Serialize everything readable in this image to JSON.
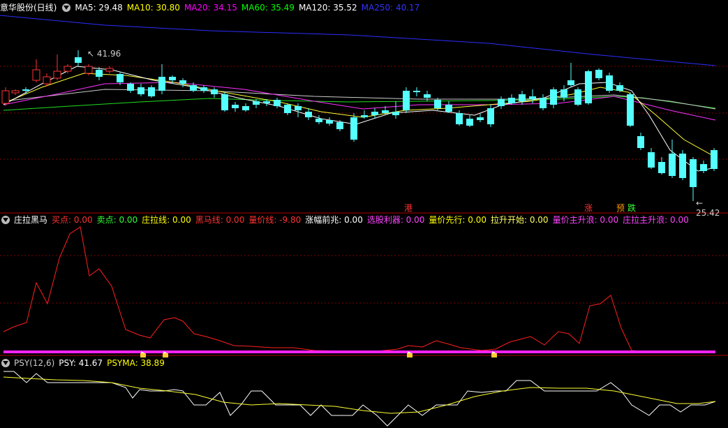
{
  "price_panel": {
    "title": "意华股份(日线)",
    "title_color": "#ffffff",
    "indicators": [
      {
        "label": "MA5: 29.48",
        "color": "#ffffff"
      },
      {
        "label": "MA10: 30.80",
        "color": "#ffff00"
      },
      {
        "label": "MA20: 34.15",
        "color": "#ff00ff"
      },
      {
        "label": "MA60: 35.49",
        "color": "#00ff00"
      },
      {
        "label": "MA120: 35.52",
        "color": "#ffffff"
      },
      {
        "label": "MA250: 40.17",
        "color": "#3333ff"
      }
    ],
    "high_label": "41.96",
    "low_label": "25.42",
    "signals": [
      {
        "text": "港",
        "color": "#ff3333"
      },
      {
        "text": "涨",
        "color": "#ff3333"
      },
      {
        "text": "预",
        "color": "#ff9900"
      },
      {
        "text": "跌",
        "color": "#33ff33"
      }
    ]
  },
  "zlhm_panel": {
    "title": "庄拉黑马",
    "title_color": "#ffffff",
    "indicators": [
      {
        "label": "买点: 0.00",
        "color": "#ff3333"
      },
      {
        "label": "卖点: 0.00",
        "color": "#33ff33"
      },
      {
        "label": "庄拉线: 0.00",
        "color": "#ffff00"
      },
      {
        "label": "黑马线: 0.00",
        "color": "#ff3333"
      },
      {
        "label": "量价线: -9.80",
        "color": "#ff3333"
      },
      {
        "label": "涨幅前兆: 0.00",
        "color": "#ffffff"
      },
      {
        "label": "选股利器: 0.00",
        "color": "#ff44ff"
      },
      {
        "label": "量价先行: 0.00",
        "color": "#ffff00"
      },
      {
        "label": "拉升开始: 0.00",
        "color": "#ffff66"
      },
      {
        "label": "量价主升浪: 0.00",
        "color": "#ff44ff"
      },
      {
        "label": "庄拉主升浪: 0.00",
        "color": "#ff44ff"
      }
    ]
  },
  "psy_panel": {
    "title": "PSY(12,6)",
    "title_color": "#cccccc",
    "indicators": [
      {
        "label": "PSY: 41.67",
        "color": "#ffffff"
      },
      {
        "label": "PSYMA: 38.89",
        "color": "#ffff00"
      }
    ]
  },
  "colors": {
    "up": "#ff3333",
    "down": "#54ffff",
    "grid": "#800000",
    "bg": "#000000",
    "separator": "#b00000"
  }
}
